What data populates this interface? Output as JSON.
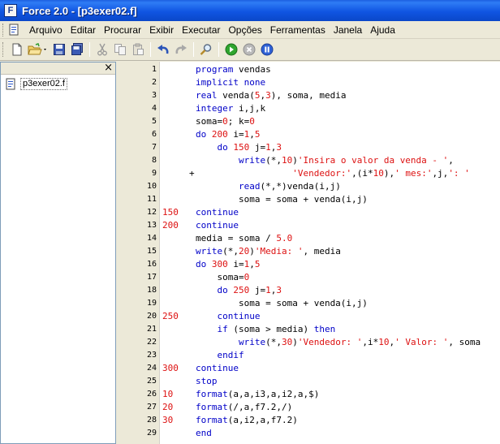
{
  "window": {
    "title": "Force 2.0 - [p3exer02.f]",
    "app_icon_letter": "F"
  },
  "menu": {
    "items": [
      "Arquivo",
      "Editar",
      "Procurar",
      "Exibir",
      "Executar",
      "Opções",
      "Ferramentas",
      "Janela",
      "Ajuda"
    ]
  },
  "toolbar": {
    "buttons": [
      "new-file-icon",
      "open-folder-icon",
      "save-icon",
      "save-all-icon",
      "cut-icon",
      "copy-icon",
      "paste-icon",
      "undo-icon",
      "redo-icon",
      "find-icon",
      "run-icon",
      "stop-icon",
      "pause-icon"
    ]
  },
  "sidebar": {
    "close_glyph": "×",
    "file_name": "p3exer02.f"
  },
  "colors": {
    "keyword": "#0000c8",
    "label": "#dd1111",
    "literal": "#dd1111",
    "titlebar": "#0a47c9"
  },
  "editor": {
    "lines": [
      {
        "n": "1",
        "label": "",
        "fold": "",
        "tokens": [
          [
            "k",
            "program"
          ],
          [
            "t",
            " vendas"
          ]
        ]
      },
      {
        "n": "2",
        "label": "",
        "fold": "",
        "tokens": [
          [
            "k",
            "implicit"
          ],
          [
            "t",
            " "
          ],
          [
            "k",
            "none"
          ]
        ]
      },
      {
        "n": "3",
        "label": "",
        "fold": "",
        "tokens": [
          [
            "k",
            "real"
          ],
          [
            "t",
            " venda("
          ],
          [
            "n",
            "5"
          ],
          [
            "t",
            ","
          ],
          [
            "n",
            "3"
          ],
          [
            "t",
            "), soma, media"
          ]
        ]
      },
      {
        "n": "4",
        "label": "",
        "fold": "",
        "tokens": [
          [
            "k",
            "integer"
          ],
          [
            "t",
            " i,j,k"
          ]
        ]
      },
      {
        "n": "5",
        "label": "",
        "fold": "",
        "tokens": [
          [
            "t",
            "soma="
          ],
          [
            "n",
            "0"
          ],
          [
            "t",
            "; k="
          ],
          [
            "n",
            "0"
          ]
        ]
      },
      {
        "n": "6",
        "label": "",
        "fold": "",
        "tokens": [
          [
            "k",
            "do"
          ],
          [
            "t",
            " "
          ],
          [
            "n",
            "200"
          ],
          [
            "t",
            " i="
          ],
          [
            "n",
            "1"
          ],
          [
            "t",
            ","
          ],
          [
            "n",
            "5"
          ]
        ]
      },
      {
        "n": "7",
        "label": "",
        "fold": "",
        "tokens": [
          [
            "t",
            "    "
          ],
          [
            "k",
            "do"
          ],
          [
            "t",
            " "
          ],
          [
            "n",
            "150"
          ],
          [
            "t",
            " j="
          ],
          [
            "n",
            "1"
          ],
          [
            "t",
            ","
          ],
          [
            "n",
            "3"
          ]
        ]
      },
      {
        "n": "8",
        "label": "",
        "fold": "",
        "tokens": [
          [
            "t",
            "        "
          ],
          [
            "k",
            "write"
          ],
          [
            "t",
            "(*,"
          ],
          [
            "n",
            "10"
          ],
          [
            "t",
            ")"
          ],
          [
            "s",
            "'Insira o valor da venda - '"
          ],
          [
            "t",
            ","
          ]
        ]
      },
      {
        "n": "9",
        "label": "",
        "fold": "+",
        "tokens": [
          [
            "t",
            "                  "
          ],
          [
            "s",
            "'Vendedor:'"
          ],
          [
            "t",
            ",(i*"
          ],
          [
            "n",
            "10"
          ],
          [
            "t",
            "),"
          ],
          [
            "s",
            "' mes:'"
          ],
          [
            "t",
            ",j,"
          ],
          [
            "s",
            "': '"
          ]
        ]
      },
      {
        "n": "10",
        "label": "",
        "fold": "",
        "tokens": [
          [
            "t",
            "        "
          ],
          [
            "k",
            "read"
          ],
          [
            "t",
            "(*,*)venda(i,j)"
          ]
        ]
      },
      {
        "n": "11",
        "label": "",
        "fold": "",
        "tokens": [
          [
            "t",
            "        soma = soma + venda(i,j)"
          ]
        ]
      },
      {
        "n": "12",
        "label": "150",
        "fold": "",
        "tokens": [
          [
            "k",
            "continue"
          ]
        ]
      },
      {
        "n": "13",
        "label": "200",
        "fold": "",
        "tokens": [
          [
            "k",
            "continue"
          ]
        ]
      },
      {
        "n": "14",
        "label": "",
        "fold": "",
        "tokens": [
          [
            "t",
            "media = soma / "
          ],
          [
            "n",
            "5.0"
          ]
        ]
      },
      {
        "n": "15",
        "label": "",
        "fold": "",
        "tokens": [
          [
            "k",
            "write"
          ],
          [
            "t",
            "(*,"
          ],
          [
            "n",
            "20"
          ],
          [
            "t",
            ")"
          ],
          [
            "s",
            "'Media: '"
          ],
          [
            "t",
            ", media"
          ]
        ]
      },
      {
        "n": "16",
        "label": "",
        "fold": "",
        "tokens": [
          [
            "k",
            "do"
          ],
          [
            "t",
            " "
          ],
          [
            "n",
            "300"
          ],
          [
            "t",
            " i="
          ],
          [
            "n",
            "1"
          ],
          [
            "t",
            ","
          ],
          [
            "n",
            "5"
          ]
        ]
      },
      {
        "n": "17",
        "label": "",
        "fold": "",
        "tokens": [
          [
            "t",
            "    soma="
          ],
          [
            "n",
            "0"
          ]
        ]
      },
      {
        "n": "18",
        "label": "",
        "fold": "",
        "tokens": [
          [
            "t",
            "    "
          ],
          [
            "k",
            "do"
          ],
          [
            "t",
            " "
          ],
          [
            "n",
            "250"
          ],
          [
            "t",
            " j="
          ],
          [
            "n",
            "1"
          ],
          [
            "t",
            ","
          ],
          [
            "n",
            "3"
          ]
        ]
      },
      {
        "n": "19",
        "label": "",
        "fold": "",
        "tokens": [
          [
            "t",
            "        soma = soma + venda(i,j)"
          ]
        ]
      },
      {
        "n": "20",
        "label": "250",
        "fold": "",
        "tokens": [
          [
            "t",
            "    "
          ],
          [
            "k",
            "continue"
          ]
        ]
      },
      {
        "n": "21",
        "label": "",
        "fold": "",
        "tokens": [
          [
            "t",
            "    "
          ],
          [
            "k",
            "if"
          ],
          [
            "t",
            " (soma > media) "
          ],
          [
            "k",
            "then"
          ]
        ]
      },
      {
        "n": "22",
        "label": "",
        "fold": "",
        "tokens": [
          [
            "t",
            "        "
          ],
          [
            "k",
            "write"
          ],
          [
            "t",
            "(*,"
          ],
          [
            "n",
            "30"
          ],
          [
            "t",
            ")"
          ],
          [
            "s",
            "'Vendedor: '"
          ],
          [
            "t",
            ",i*"
          ],
          [
            "n",
            "10"
          ],
          [
            "t",
            ","
          ],
          [
            "s",
            "' Valor: '"
          ],
          [
            "t",
            ", soma"
          ]
        ]
      },
      {
        "n": "23",
        "label": "",
        "fold": "",
        "tokens": [
          [
            "t",
            "    "
          ],
          [
            "k",
            "endif"
          ]
        ]
      },
      {
        "n": "24",
        "label": "300",
        "fold": "",
        "tokens": [
          [
            "k",
            "continue"
          ]
        ]
      },
      {
        "n": "25",
        "label": "",
        "fold": "",
        "tokens": [
          [
            "k",
            "stop"
          ]
        ]
      },
      {
        "n": "26",
        "label": "10",
        "fold": "",
        "tokens": [
          [
            "k",
            "format"
          ],
          [
            "t",
            "(a,a,i3,a,i2,a,$)"
          ]
        ]
      },
      {
        "n": "27",
        "label": "20",
        "fold": "",
        "tokens": [
          [
            "k",
            "format"
          ],
          [
            "t",
            "(/,a,f7.2,/)"
          ]
        ]
      },
      {
        "n": "28",
        "label": "30",
        "fold": "",
        "tokens": [
          [
            "k",
            "format"
          ],
          [
            "t",
            "(a,i2,a,f7.2)"
          ]
        ]
      },
      {
        "n": "29",
        "label": "",
        "fold": "",
        "tokens": [
          [
            "k",
            "end"
          ]
        ]
      }
    ]
  }
}
